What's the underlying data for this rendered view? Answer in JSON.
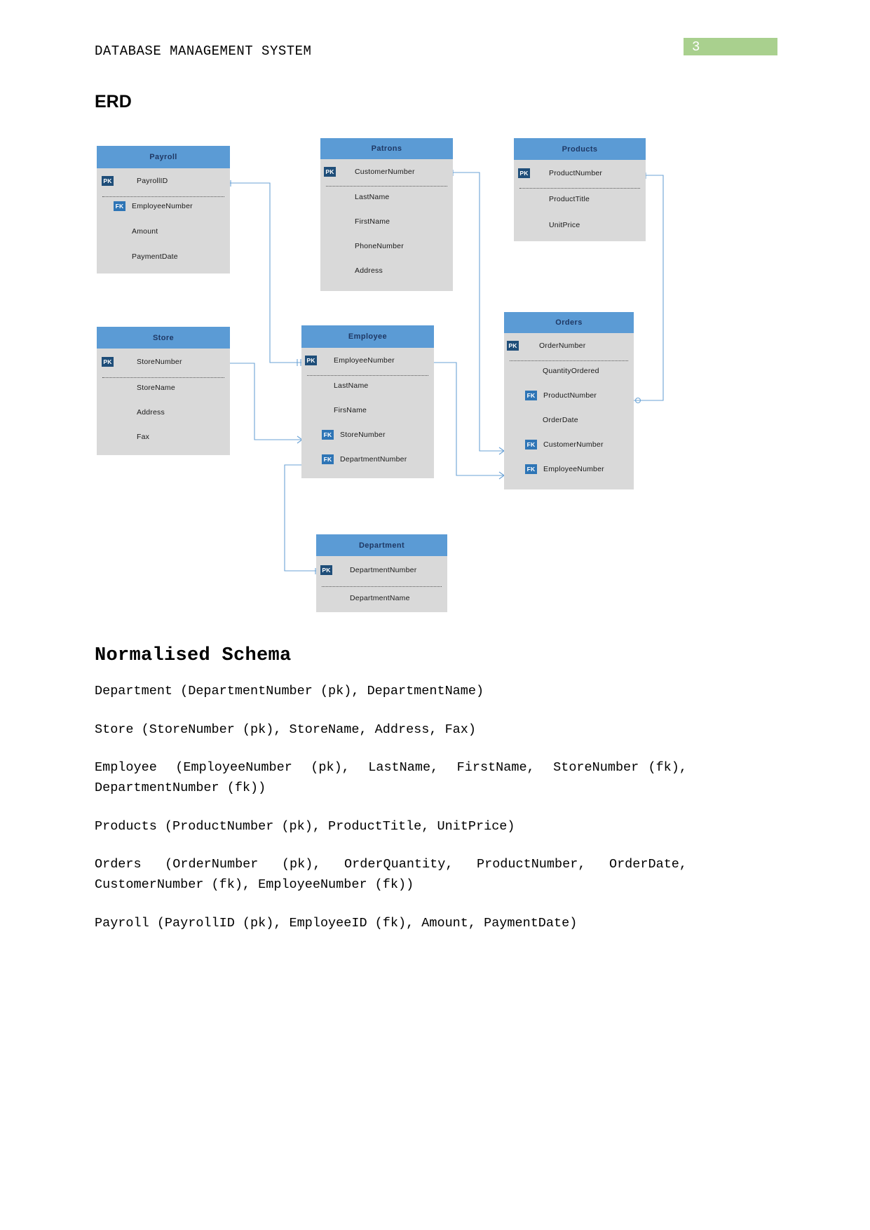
{
  "header": {
    "running_title": "DATABASE MANAGEMENT SYSTEM",
    "page_number": "3",
    "badge_color": "#a9d08e"
  },
  "headings": {
    "erd": "ERD",
    "schema": "Normalised Schema"
  },
  "erd": {
    "colors": {
      "entity_header": "#5b9bd5",
      "entity_body": "#d9d9d9",
      "pk_badge": "#1f4e79",
      "fk_badge": "#2e75b6",
      "relation_line": "#6ba3d6"
    },
    "entities": [
      {
        "name": "Payroll",
        "rows": [
          {
            "key": "PK",
            "label": "PayrollID"
          },
          {
            "key": "FK",
            "label": "EmployeeNumber"
          },
          {
            "key": "",
            "label": "Amount"
          },
          {
            "key": "",
            "label": "PaymentDate"
          }
        ]
      },
      {
        "name": "Patrons",
        "rows": [
          {
            "key": "PK",
            "label": "CustomerNumber"
          },
          {
            "key": "",
            "label": "LastName"
          },
          {
            "key": "",
            "label": "FirstName"
          },
          {
            "key": "",
            "label": "PhoneNumber"
          },
          {
            "key": "",
            "label": "Address"
          }
        ]
      },
      {
        "name": "Products",
        "rows": [
          {
            "key": "PK",
            "label": "ProductNumber"
          },
          {
            "key": "",
            "label": "ProductTitle"
          },
          {
            "key": "",
            "label": "UnitPrice"
          }
        ]
      },
      {
        "name": "Store",
        "rows": [
          {
            "key": "PK",
            "label": "StoreNumber"
          },
          {
            "key": "",
            "label": "StoreName"
          },
          {
            "key": "",
            "label": "Address"
          },
          {
            "key": "",
            "label": "Fax"
          }
        ]
      },
      {
        "name": "Employee",
        "rows": [
          {
            "key": "PK",
            "label": "EmployeeNumber"
          },
          {
            "key": "",
            "label": "LastName"
          },
          {
            "key": "",
            "label": "FirsName"
          },
          {
            "key": "FK",
            "label": "StoreNumber"
          },
          {
            "key": "FK",
            "label": "DepartmentNumber"
          }
        ]
      },
      {
        "name": "Orders",
        "rows": [
          {
            "key": "PK",
            "label": "OrderNumber"
          },
          {
            "key": "",
            "label": "QuantityOrdered"
          },
          {
            "key": "FK",
            "label": "ProductNumber"
          },
          {
            "key": "",
            "label": "OrderDate"
          },
          {
            "key": "FK",
            "label": "CustomerNumber"
          },
          {
            "key": "FK",
            "label": "EmployeeNumber"
          }
        ]
      },
      {
        "name": "Department",
        "rows": [
          {
            "key": "PK",
            "label": "DepartmentNumber"
          },
          {
            "key": "",
            "label": "DepartmentName"
          }
        ]
      }
    ]
  },
  "schema": {
    "relations": [
      "Department (DepartmentNumber (pk), DepartmentName)",
      "Store (StoreNumber (pk), StoreName, Address, Fax)",
      "Employee  (EmployeeNumber  (pk),  LastName,  FirstName,  StoreNumber (fk), DepartmentNumber (fk))",
      "Products (ProductNumber (pk), ProductTitle, UnitPrice)",
      "Orders  (OrderNumber  (pk),  OrderQuantity,  ProductNumber,  OrderDate, CustomerNumber (fk), EmployeeNumber (fk))",
      "Payroll (PayrollID (pk), EmployeeID (fk), Amount, PaymentDate)"
    ]
  }
}
